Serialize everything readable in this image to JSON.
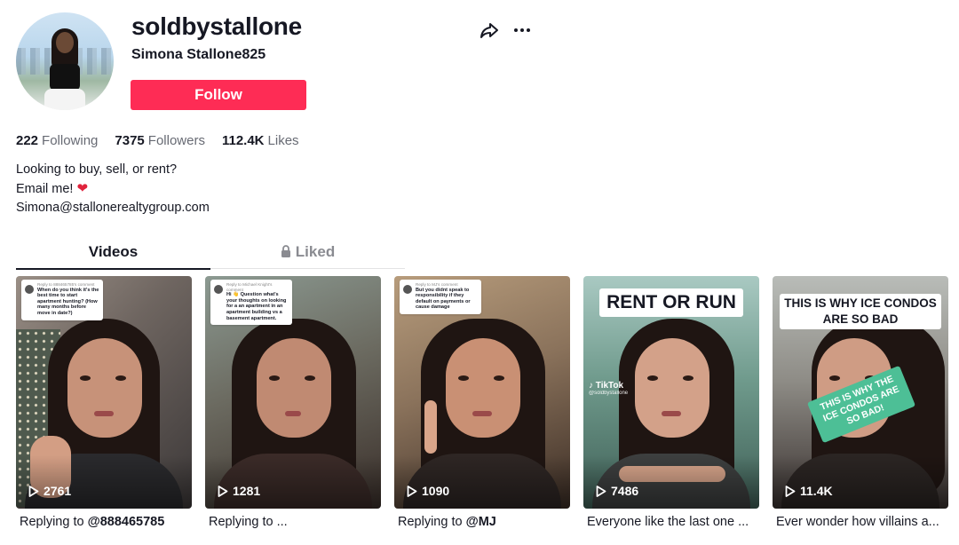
{
  "profile": {
    "username": "soldbystallone",
    "nickname": "Simona Stallone825",
    "follow_label": "Follow"
  },
  "stats": {
    "following_count": "222",
    "following_label": "Following",
    "followers_count": "7375",
    "followers_label": "Followers",
    "likes_count": "112.4K",
    "likes_label": "Likes"
  },
  "bio": {
    "line1": "Looking to buy, sell, or rent?",
    "line2": "Email me!",
    "line3": "Simona@stallonerealtygroup.com"
  },
  "tabs": {
    "videos": "Videos",
    "liked": "Liked"
  },
  "videos": [
    {
      "views": "2761",
      "caption_prefix": "Replying to ",
      "caption_bold": "@888465785",
      "reply_header": "Reply to 888465785's comment",
      "reply_text": "When do you think it's the best time to start apartment hunting? (How many months before move in date?)"
    },
    {
      "views": "1281",
      "caption_prefix": "Replying to ...",
      "caption_bold": "",
      "reply_header": "Reply to Michael Knight's comment",
      "reply_text": "Hi 👋 Question what's your thoughts on looking for a an apartment in an apartment building vs a basement apartment."
    },
    {
      "views": "1090",
      "caption_prefix": "Replying to ",
      "caption_bold": "@MJ",
      "reply_header": "Reply to MJ's comment",
      "reply_text": "But you didnt speak to responsibility if they default on payments or cause damage"
    },
    {
      "views": "7486",
      "caption_prefix": "Everyone like the last one ...",
      "caption_bold": "",
      "overlay": "RENT OR RUN",
      "watermark": "TikTok",
      "watermark_handle": "@soldbystallone"
    },
    {
      "views": "11.4K",
      "caption_prefix": "Ever wonder how villains a...",
      "caption_bold": "",
      "overlay_line1": "THIS IS WHY ICE CONDOS",
      "overlay_line2": "ARE SO BAD",
      "banner": "THIS IS WHY THE ICE CONDOS ARE SO BAD!"
    }
  ],
  "colors": {
    "accent": "#fe2c55",
    "text": "#161823",
    "muted": "#676a73",
    "banner_green": "#4dbf96"
  }
}
